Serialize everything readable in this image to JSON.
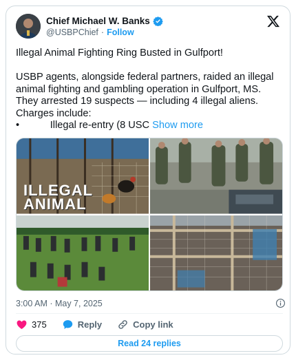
{
  "author": {
    "name": "Chief Michael W. Banks",
    "handle": "@USBPChief",
    "separator": "·",
    "follow_label": "Follow"
  },
  "post": {
    "text": "Illegal Animal Fighting Ring Busted in Gulfport!\n\nUSBP agents, alongside federal partners, raided an illegal animal fighting and gambling operation in Gulfport, MS. They arrested 19 suspects — including 4 illegal aliens. Charges include:\n•           Illegal re-entry (8 USC ",
    "show_more_label": "Show more",
    "image_overlay_text": "ILLEGAL ANIMAL"
  },
  "meta": {
    "timestamp": "3:00 AM · May 7, 2025"
  },
  "actions": {
    "like_count": "375",
    "reply_label": "Reply",
    "copy_link_label": "Copy link"
  },
  "read_replies_label": "Read 24 replies",
  "colors": {
    "accent": "#1d9bf0",
    "like": "#f91880",
    "secondary_text": "#536471",
    "border": "#cfd9de"
  }
}
